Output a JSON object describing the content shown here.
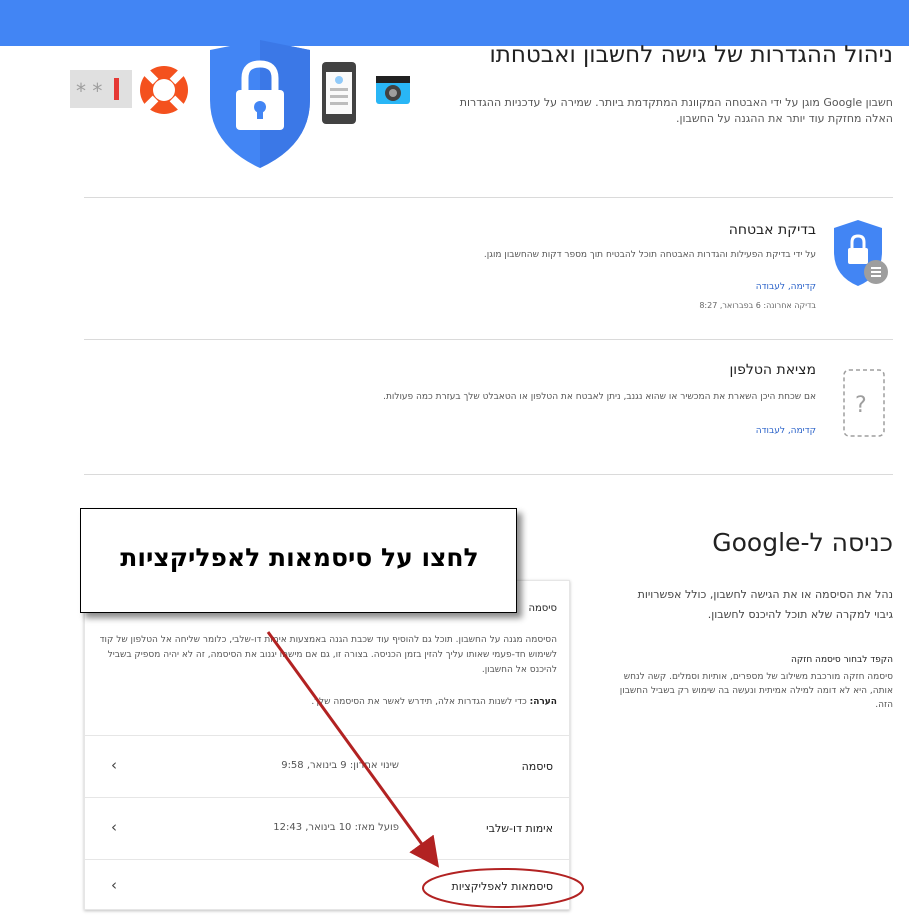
{
  "header": {
    "bar_color": "#4285f4"
  },
  "hero": {
    "icons": [
      "password-field-icon",
      "lifebuoy-icon",
      "shield-lock-icon",
      "phone-icon",
      "camera-icon"
    ]
  },
  "page": {
    "title": "ניהול ההגדרות של גישה לחשבון ואבטחתו",
    "intro": "חשבון Google מוגן על ידי האבטחה המקוונת המתקדמת ביותר. שמירה על עדכניות ההגדרות האלה מחזקת עוד יותר את ההגנה על החשבון."
  },
  "security_checkup": {
    "title": "בדיקת אבטחה",
    "desc": "על ידי בדיקת הפעילות והגדרות האבטחה תוכל להבטיח תוך מספר דקות שהחשבון מוגן.",
    "link": "קדימה, לעבודה",
    "meta": "בדיקה אחרונה: 6 בפברואר, 8:27"
  },
  "find_phone": {
    "title": "מציאת הטלפון",
    "desc": "אם שכחת היכן השארת את המכשיר או שהוא נגנב, ניתן לאבטח את הטלפון או הטאבלט שלך בעזרת כמה פעולות.",
    "link": "קדימה, לעבודה"
  },
  "signin": {
    "title": "כניסה ל-Google",
    "desc": "נהל את הסיסמה או את הגישה לחשבון, כולל אפשרויות גיבוי למקרה שלא תוכל להיכנס לחשבון.",
    "tip_title": "הקפד לבחור סיסמה חזקה",
    "tip_body": "סיסמה חזקה מורכבת משילוב של מספרים, אותיות וסמלים. קשה לנחש אותה, היא לא דומה למילה אמיתית ונעשה בה שימוש רק בשביל החשבון הזה."
  },
  "card": {
    "header": "סיסמה",
    "desc": "הסיסמה מגנה על החשבון. תוכל גם להוסיף עוד שכבת הגנה באמצעות אימות דו-שלבי, כלומר שליחה אל הטלפון של קוד לשימוש חד-פעמי שאותו עליך להזין בזמן הכניסה. בצורה זו, גם אם מישהו יגנוב את הסיסמה, זה לא יהיה מספיק בשביל להיכנס אל החשבון.",
    "note_label": "הערה:",
    "note_text": " כדי לשנות הגדרות אלה, תידרש לאשר את הסיסמה שלך.",
    "rows": [
      {
        "label": "סיסמה",
        "value": "שינוי אחרון: 9 בינואר, 9:58",
        "chevron": "‹"
      },
      {
        "label": "אימות דו-שלבי",
        "value": "פועל מאז: 10 בינואר, 12:43",
        "chevron": "‹"
      },
      {
        "label": "סיסמאות לאפליקציות",
        "value": "",
        "chevron": "‹"
      }
    ]
  },
  "annotation": {
    "callout_text": "לחצו על סיסמאות לאפליקציות",
    "arrow_color": "#b22222"
  }
}
